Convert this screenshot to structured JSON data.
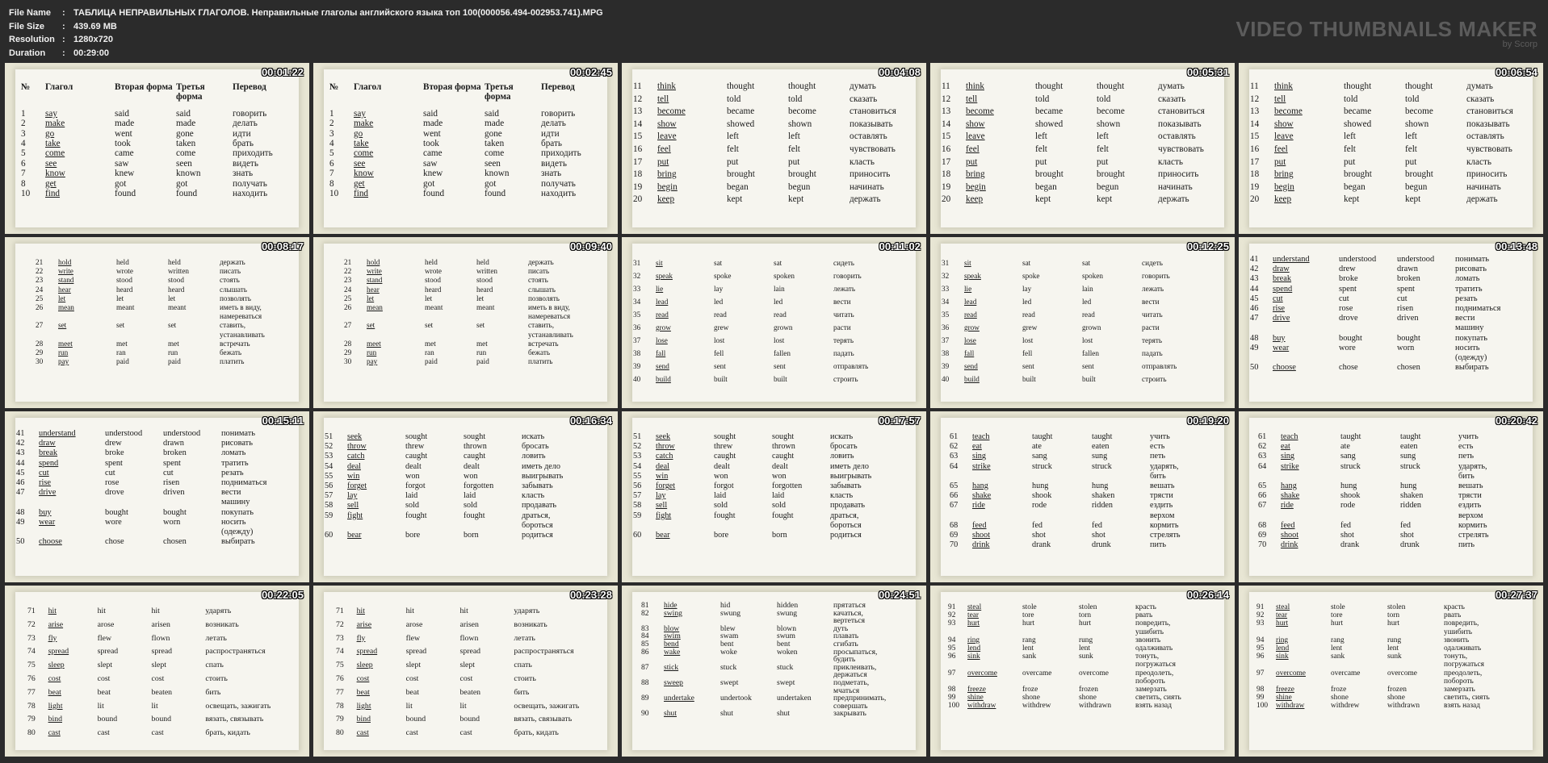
{
  "header": {
    "rows": [
      {
        "label": "File Name",
        "value": "ТАБЛИЦА НЕПРАВИЛЬНЫХ ГЛАГОЛОВ. Неправильные глаголы английского языка топ 100(000056.494-002953.741).MPG"
      },
      {
        "label": "File Size",
        "value": "439.69 MB"
      },
      {
        "label": "Resolution",
        "value": "1280x720"
      },
      {
        "label": "Duration",
        "value": "00:29:00"
      }
    ],
    "separator": ":",
    "logo_title": "VIDEO THUMBNAILS MAKER",
    "logo_sub": "by Scorp"
  },
  "table_headers": {
    "num": "№",
    "verb": "Глагол",
    "second": [
      "Вторая",
      "форма"
    ],
    "third": [
      "Третья",
      "форма"
    ],
    "translation": "Перевод"
  },
  "groups": [
    [
      {
        "n": "1",
        "v": "say",
        "f2": "said",
        "f3": "said",
        "t": [
          "говорить"
        ]
      },
      {
        "n": "2",
        "v": "make",
        "f2": "made",
        "f3": "made",
        "t": [
          "делать"
        ]
      },
      {
        "n": "3",
        "v": "go",
        "f2": "went",
        "f3": "gone",
        "t": [
          "идти"
        ]
      },
      {
        "n": "4",
        "v": "take",
        "f2": "took",
        "f3": "taken",
        "t": [
          "брать"
        ]
      },
      {
        "n": "5",
        "v": "come",
        "f2": "came",
        "f3": "come",
        "t": [
          "приходить"
        ]
      },
      {
        "n": "6",
        "v": "see",
        "f2": "saw",
        "f3": "seen",
        "t": [
          "видеть"
        ]
      },
      {
        "n": "7",
        "v": "know",
        "f2": "knew",
        "f3": "known",
        "t": [
          "знать"
        ]
      },
      {
        "n": "8",
        "v": "get",
        "f2": "got",
        "f3": "got",
        "t": [
          "получать"
        ]
      },
      {
        "n": "10",
        "v": "find",
        "f2": "found",
        "f3": "found",
        "t": [
          "находить"
        ]
      }
    ],
    [
      {
        "n": "11",
        "v": "think",
        "f2": "thought",
        "f3": "thought",
        "t": [
          "думать"
        ]
      },
      {
        "n": "12",
        "v": "tell",
        "f2": "told",
        "f3": "told",
        "t": [
          "сказать"
        ]
      },
      {
        "n": "13",
        "v": "become",
        "f2": "became",
        "f3": "become",
        "t": [
          "становиться"
        ]
      },
      {
        "n": "14",
        "v": "show",
        "f2": "showed",
        "f3": "shown",
        "t": [
          "показывать"
        ]
      },
      {
        "n": "15",
        "v": "leave",
        "f2": "left",
        "f3": "left",
        "t": [
          "оставлять"
        ]
      },
      {
        "n": "16",
        "v": "feel",
        "f2": "felt",
        "f3": "felt",
        "t": [
          "чувствовать"
        ]
      },
      {
        "n": "17",
        "v": "put",
        "f2": "put",
        "f3": "put",
        "t": [
          "класть"
        ]
      },
      {
        "n": "18",
        "v": "bring",
        "f2": "brought",
        "f3": "brought",
        "t": [
          "приносить"
        ]
      },
      {
        "n": "19",
        "v": "begin",
        "f2": "began",
        "f3": "begun",
        "t": [
          "начинать"
        ]
      },
      {
        "n": "20",
        "v": "keep",
        "f2": "kept",
        "f3": "kept",
        "t": [
          "держать"
        ]
      }
    ],
    [
      {
        "n": "21",
        "v": "hold",
        "f2": "held",
        "f3": "held",
        "t": [
          "держать"
        ]
      },
      {
        "n": "22",
        "v": "write",
        "f2": "wrote",
        "f3": "written",
        "t": [
          "писать"
        ]
      },
      {
        "n": "23",
        "v": "stand",
        "f2": "stood",
        "f3": "stood",
        "t": [
          "стоять"
        ]
      },
      {
        "n": "24",
        "v": "hear",
        "f2": "heard",
        "f3": "heard",
        "t": [
          "слышать"
        ]
      },
      {
        "n": "25",
        "v": "let",
        "f2": "let",
        "f3": "let",
        "t": [
          "позволять"
        ]
      },
      {
        "n": "26",
        "v": "mean",
        "f2": "meant",
        "f3": "meant",
        "t": [
          "иметь в виду,",
          "намереваться"
        ]
      },
      {
        "n": "27",
        "v": "set",
        "f2": "set",
        "f3": "set",
        "t": [
          "ставить,",
          "устанавливать"
        ]
      },
      {
        "n": "28",
        "v": "meet",
        "f2": "met",
        "f3": "met",
        "t": [
          "встречать"
        ]
      },
      {
        "n": "29",
        "v": "run",
        "f2": "ran",
        "f3": "run",
        "t": [
          "бежать"
        ]
      },
      {
        "n": "30",
        "v": "pay",
        "f2": "paid",
        "f3": "paid",
        "t": [
          "платить"
        ]
      }
    ],
    [
      {
        "n": "31",
        "v": "sit",
        "f2": "sat",
        "f3": "sat",
        "t": [
          "сидеть"
        ]
      },
      {
        "n": "32",
        "v": "speak",
        "f2": "spoke",
        "f3": "spoken",
        "t": [
          "говорить"
        ]
      },
      {
        "n": "33",
        "v": "lie",
        "f2": "lay",
        "f3": "lain",
        "t": [
          "лежать"
        ]
      },
      {
        "n": "34",
        "v": "lead",
        "f2": "led",
        "f3": "led",
        "t": [
          "вести"
        ]
      },
      {
        "n": "35",
        "v": "read",
        "f2": "read",
        "f3": "read",
        "t": [
          "читать"
        ]
      },
      {
        "n": "36",
        "v": "grow",
        "f2": "grew",
        "f3": "grown",
        "t": [
          "расти"
        ]
      },
      {
        "n": "37",
        "v": "lose",
        "f2": "lost",
        "f3": "lost",
        "t": [
          "терять"
        ]
      },
      {
        "n": "38",
        "v": "fall",
        "f2": "fell",
        "f3": "fallen",
        "t": [
          "падать"
        ]
      },
      {
        "n": "39",
        "v": "send",
        "f2": "sent",
        "f3": "sent",
        "t": [
          "отправлять"
        ]
      },
      {
        "n": "40",
        "v": "build",
        "f2": "built",
        "f3": "built",
        "t": [
          "строить"
        ]
      }
    ],
    [
      {
        "n": "41",
        "v": "understand",
        "f2": "understood",
        "f3": "understood",
        "t": [
          "понимать"
        ]
      },
      {
        "n": "42",
        "v": "draw",
        "f2": "drew",
        "f3": "drawn",
        "t": [
          "рисовать"
        ]
      },
      {
        "n": "43",
        "v": "break",
        "f2": "broke",
        "f3": "broken",
        "t": [
          "ломать"
        ]
      },
      {
        "n": "44",
        "v": "spend",
        "f2": "spent",
        "f3": "spent",
        "t": [
          "тратить"
        ]
      },
      {
        "n": "45",
        "v": "cut",
        "f2": "cut",
        "f3": "cut",
        "t": [
          "резать"
        ]
      },
      {
        "n": "46",
        "v": "rise",
        "f2": "rose",
        "f3": "risen",
        "t": [
          "подниматься"
        ]
      },
      {
        "n": "47",
        "v": "drive",
        "f2": "drove",
        "f3": "driven",
        "t": [
          "вести",
          "машину"
        ]
      },
      {
        "n": "48",
        "v": "buy",
        "f2": "bought",
        "f3": "bought",
        "t": [
          "покупать"
        ]
      },
      {
        "n": "49",
        "v": "wear",
        "f2": "wore",
        "f3": "worn",
        "t": [
          "носить",
          "(одежду)"
        ]
      },
      {
        "n": "50",
        "v": "choose",
        "f2": "chose",
        "f3": "chosen",
        "t": [
          "выбирать"
        ]
      }
    ],
    [
      {
        "n": "51",
        "v": "seek",
        "f2": "sought",
        "f3": "sought",
        "t": [
          "искать"
        ]
      },
      {
        "n": "52",
        "v": "throw",
        "f2": "threw",
        "f3": "thrown",
        "t": [
          "бросать"
        ]
      },
      {
        "n": "53",
        "v": "catch",
        "f2": "caught",
        "f3": "caught",
        "t": [
          "ловить"
        ]
      },
      {
        "n": "54",
        "v": "deal",
        "f2": "dealt",
        "f3": "dealt",
        "t": [
          "иметь дело"
        ]
      },
      {
        "n": "55",
        "v": "win",
        "f2": "won",
        "f3": "won",
        "t": [
          "выигрывать"
        ]
      },
      {
        "n": "56",
        "v": "forget",
        "f2": "forgot",
        "f3": "forgotten",
        "t": [
          "забывать"
        ]
      },
      {
        "n": "57",
        "v": "lay",
        "f2": "laid",
        "f3": "laid",
        "t": [
          "класть"
        ]
      },
      {
        "n": "58",
        "v": "sell",
        "f2": "sold",
        "f3": "sold",
        "t": [
          "продавать"
        ]
      },
      {
        "n": "59",
        "v": "fight",
        "f2": "fought",
        "f3": "fought",
        "t": [
          "драться,",
          "бороться"
        ]
      },
      {
        "n": "60",
        "v": "bear",
        "f2": "bore",
        "f3": "born",
        "t": [
          "родиться"
        ]
      }
    ],
    [
      {
        "n": "61",
        "v": "teach",
        "f2": "taught",
        "f3": "taught",
        "t": [
          "учить"
        ]
      },
      {
        "n": "62",
        "v": "eat",
        "f2": "ate",
        "f3": "eaten",
        "t": [
          "есть"
        ]
      },
      {
        "n": "63",
        "v": "sing",
        "f2": "sang",
        "f3": "sung",
        "t": [
          "петь"
        ]
      },
      {
        "n": "64",
        "v": "strike",
        "f2": "struck",
        "f3": "struck",
        "t": [
          "ударять,",
          "бить"
        ]
      },
      {
        "n": "65",
        "v": "hang",
        "f2": "hung",
        "f3": "hung",
        "t": [
          "вешать"
        ]
      },
      {
        "n": "66",
        "v": "shake",
        "f2": "shook",
        "f3": "shaken",
        "t": [
          "трясти"
        ]
      },
      {
        "n": "67",
        "v": "ride",
        "f2": "rode",
        "f3": "ridden",
        "t": [
          "ездить",
          "верхом"
        ]
      },
      {
        "n": "68",
        "v": "feed",
        "f2": "fed",
        "f3": "fed",
        "t": [
          "кормить"
        ]
      },
      {
        "n": "69",
        "v": "shoot",
        "f2": "shot",
        "f3": "shot",
        "t": [
          "стрелять"
        ]
      },
      {
        "n": "70",
        "v": "drink",
        "f2": "drank",
        "f3": "drunk",
        "t": [
          "пить"
        ]
      }
    ],
    [
      {
        "n": "71",
        "v": "hit",
        "f2": "hit",
        "f3": "hit",
        "t": [
          "ударять"
        ]
      },
      {
        "n": "72",
        "v": "arise",
        "f2": "arose",
        "f3": "arisen",
        "t": [
          "возникать"
        ]
      },
      {
        "n": "73",
        "v": "fly",
        "f2": "flew",
        "f3": "flown",
        "t": [
          "летать"
        ]
      },
      {
        "n": "74",
        "v": "spread",
        "f2": "spread",
        "f3": "spread",
        "t": [
          "распространяться"
        ]
      },
      {
        "n": "75",
        "v": "sleep",
        "f2": "slept",
        "f3": "slept",
        "t": [
          "спать"
        ]
      },
      {
        "n": "76",
        "v": "cost",
        "f2": "cost",
        "f3": "cost",
        "t": [
          "стоить"
        ]
      },
      {
        "n": "77",
        "v": "beat",
        "f2": "beat",
        "f3": "beaten",
        "t": [
          "бить"
        ]
      },
      {
        "n": "78",
        "v": "light",
        "f2": "lit",
        "f3": "lit",
        "t": [
          "освещать, зажигать"
        ]
      },
      {
        "n": "79",
        "v": "bind",
        "f2": "bound",
        "f3": "bound",
        "t": [
          "вязать, связывать"
        ]
      },
      {
        "n": "80",
        "v": "cast",
        "f2": "cast",
        "f3": "cast",
        "t": [
          "брать, кидать"
        ]
      }
    ],
    [
      {
        "n": "81",
        "v": "hide",
        "f2": "hid",
        "f3": "hidden",
        "t": [
          "прятаться"
        ]
      },
      {
        "n": "82",
        "v": "swing",
        "f2": "swung",
        "f3": "swung",
        "t": [
          "качаться,",
          "вертеться"
        ]
      },
      {
        "n": "83",
        "v": "blow",
        "f2": "blew",
        "f3": "blown",
        "t": [
          "дуть"
        ]
      },
      {
        "n": "84",
        "v": "swim",
        "f2": "swam",
        "f3": "swum",
        "t": [
          "плавать"
        ]
      },
      {
        "n": "85",
        "v": "bend",
        "f2": "bent",
        "f3": "bent",
        "t": [
          "сгибать"
        ]
      },
      {
        "n": "86",
        "v": "wake",
        "f2": "woke",
        "f3": "woken",
        "t": [
          "просыпаться,",
          "будить"
        ]
      },
      {
        "n": "87",
        "v": "stick",
        "f2": "stuck",
        "f3": "stuck",
        "t": [
          "приклеивать,",
          "держаться"
        ]
      },
      {
        "n": "88",
        "v": "sweep",
        "f2": "swept",
        "f3": "swept",
        "t": [
          "подметать,",
          "мчаться"
        ]
      },
      {
        "n": "89",
        "v": "undertake",
        "f2": "undertook",
        "f3": "undertaken",
        "t": [
          "предпринимать,",
          "совершать"
        ]
      },
      {
        "n": "90",
        "v": "shut",
        "f2": "shut",
        "f3": "shut",
        "t": [
          "закрывать"
        ]
      }
    ],
    [
      {
        "n": "91",
        "v": "steal",
        "f2": "stole",
        "f3": "stolen",
        "t": [
          "красть"
        ]
      },
      {
        "n": "92",
        "v": "tear",
        "f2": "tore",
        "f3": "torn",
        "t": [
          "рвать"
        ]
      },
      {
        "n": "93",
        "v": "hurt",
        "f2": "hurt",
        "f3": "hurt",
        "t": [
          "повредить,",
          "ушибить"
        ]
      },
      {
        "n": "94",
        "v": "ring",
        "f2": "rang",
        "f3": "rung",
        "t": [
          "звонить"
        ]
      },
      {
        "n": "95",
        "v": "lend",
        "f2": "lent",
        "f3": "lent",
        "t": [
          "одалживать"
        ]
      },
      {
        "n": "96",
        "v": "sink",
        "f2": "sank",
        "f3": "sunk",
        "t": [
          "тонуть,",
          "погружаться"
        ]
      },
      {
        "n": "97",
        "v": "overcome",
        "f2": "overcame",
        "f3": "overcome",
        "t": [
          "преодолеть,",
          "побороть"
        ]
      },
      {
        "n": "98",
        "v": "freeze",
        "f2": "froze",
        "f3": "frozen",
        "t": [
          "замерзать"
        ]
      },
      {
        "n": "99",
        "v": "shine",
        "f2": "shone",
        "f3": "shone",
        "t": [
          "светить, сиять"
        ]
      },
      {
        "n": "100",
        "v": "withdraw",
        "f2": "withdrew",
        "f3": "withdrawn",
        "t": [
          "взять назад"
        ]
      }
    ]
  ],
  "thumbnails": [
    {
      "time": "00:01:22",
      "group": 0
    },
    {
      "time": "00:02:45",
      "group": 0
    },
    {
      "time": "00:04:08",
      "group": 1
    },
    {
      "time": "00:05:31",
      "group": 1
    },
    {
      "time": "00:06:54",
      "group": 1
    },
    {
      "time": "00:08:17",
      "group": 2
    },
    {
      "time": "00:09:40",
      "group": 2
    },
    {
      "time": "00:11:02",
      "group": 3
    },
    {
      "time": "00:12:25",
      "group": 3
    },
    {
      "time": "00:13:48",
      "group": 4
    },
    {
      "time": "00:15:11",
      "group": 4
    },
    {
      "time": "00:16:34",
      "group": 5
    },
    {
      "time": "00:17:57",
      "group": 5
    },
    {
      "time": "00:19:20",
      "group": 6
    },
    {
      "time": "00:20:42",
      "group": 6
    },
    {
      "time": "00:22:05",
      "group": 7
    },
    {
      "time": "00:23:28",
      "group": 7
    },
    {
      "time": "00:24:51",
      "group": 8
    },
    {
      "time": "00:26:14",
      "group": 9
    },
    {
      "time": "00:27:37",
      "group": 9
    }
  ]
}
